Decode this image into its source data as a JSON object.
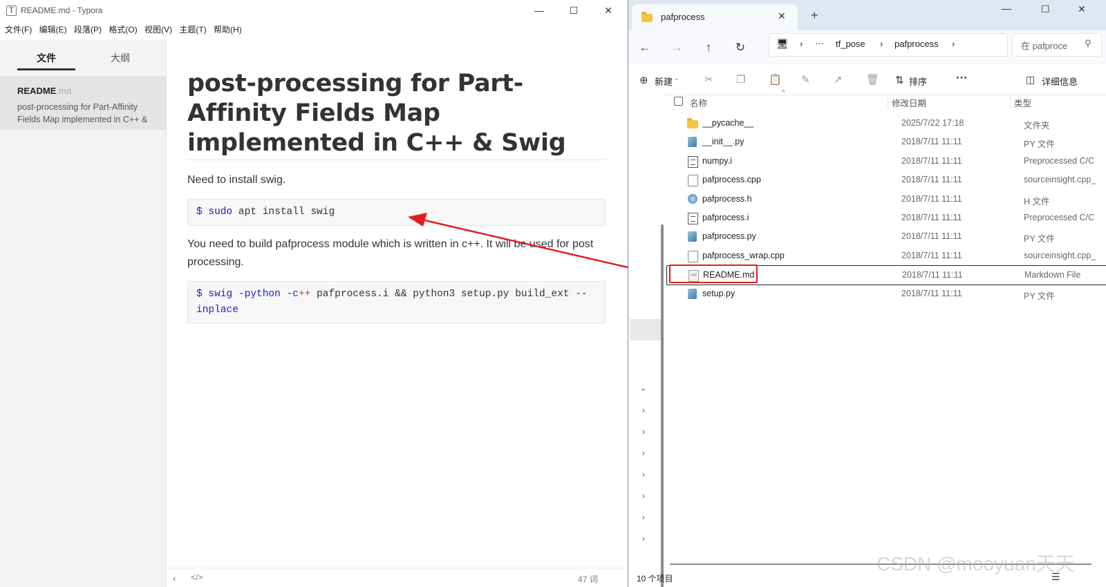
{
  "typora": {
    "window_title": "README.md - Typora",
    "app_icon_letter": "T",
    "menu": [
      "文件(F)",
      "编辑(E)",
      "段落(P)",
      "格式(O)",
      "视图(V)",
      "主题(T)",
      "帮助(H)"
    ],
    "sidebar": {
      "tabs": [
        "文件",
        "大纲"
      ],
      "active_tab": "文件",
      "file": {
        "name": "README",
        "ext": ".md",
        "preview": "post-processing for Part-Affinity Fields Map implemented in C++ &"
      }
    },
    "document": {
      "heading": "post-processing for Part-Affinity Fields Map implemented in C++ & Swig",
      "para1": "Need to install swig.",
      "code1": {
        "prompt": "$",
        "cmd": "sudo",
        "rest": " apt install swig"
      },
      "para2": "You need to build pafprocess module which is written in c++. It will be used for post processing.",
      "code2": {
        "prompt": "$",
        "cmd": "swig",
        "flag1": "-python",
        "flag2_a": "-c",
        "flag2_b": "++",
        "middle": " pafprocess.i && python3 setup.py build_ext ",
        "flag3_a": "--",
        "flag3_b": "inplace"
      }
    },
    "status": {
      "word_count": "47 词"
    }
  },
  "explorer": {
    "tab_title": "pafprocess",
    "breadcrumb": [
      "tf_pose",
      "pafprocess"
    ],
    "search_placeholder": "在 pafproce",
    "commands": {
      "new": "新建",
      "sort": "排序",
      "details": "详细信息"
    },
    "columns": {
      "name": "名称",
      "date": "修改日期",
      "type": "类型"
    },
    "files": [
      {
        "name": "__pycache__",
        "date": "2025/7/22 17:18",
        "type": "文件夹",
        "icon": "folder-icon"
      },
      {
        "name": "__init__.py",
        "date": "2018/7/11 11:11",
        "type": "PY 文件",
        "icon": "python-file-icon"
      },
      {
        "name": "numpy.i",
        "date": "2018/7/11 11:11",
        "type": "Preprocessed C/C",
        "icon": "text-file-icon"
      },
      {
        "name": "pafprocess.cpp",
        "date": "2018/7/11 11:11",
        "type": "sourceinsight.cpp_",
        "icon": "blank-file-icon"
      },
      {
        "name": "pafprocess.h",
        "date": "2018/7/11 11:11",
        "type": "H 文件",
        "icon": "header-file-icon"
      },
      {
        "name": "pafprocess.i",
        "date": "2018/7/11 11:11",
        "type": "Preprocessed C/C",
        "icon": "text-file-icon"
      },
      {
        "name": "pafprocess.py",
        "date": "2018/7/11 11:11",
        "type": "PY 文件",
        "icon": "python-file-icon"
      },
      {
        "name": "pafprocess_wrap.cpp",
        "date": "2018/7/11 11:11",
        "type": "sourceinsight.cpp_",
        "icon": "blank-file-icon"
      },
      {
        "name": "README.md",
        "date": "2018/7/11 11:11",
        "type": "Markdown File",
        "icon": "markdown-file-icon"
      },
      {
        "name": "setup.py",
        "date": "2018/7/11 11:11",
        "type": "PY 文件",
        "icon": "python-file-icon"
      }
    ],
    "status": {
      "item_count": "10 个项目"
    }
  },
  "watermark": "CSDN @mooyuan天天",
  "annotation_color": "#e31e1e"
}
